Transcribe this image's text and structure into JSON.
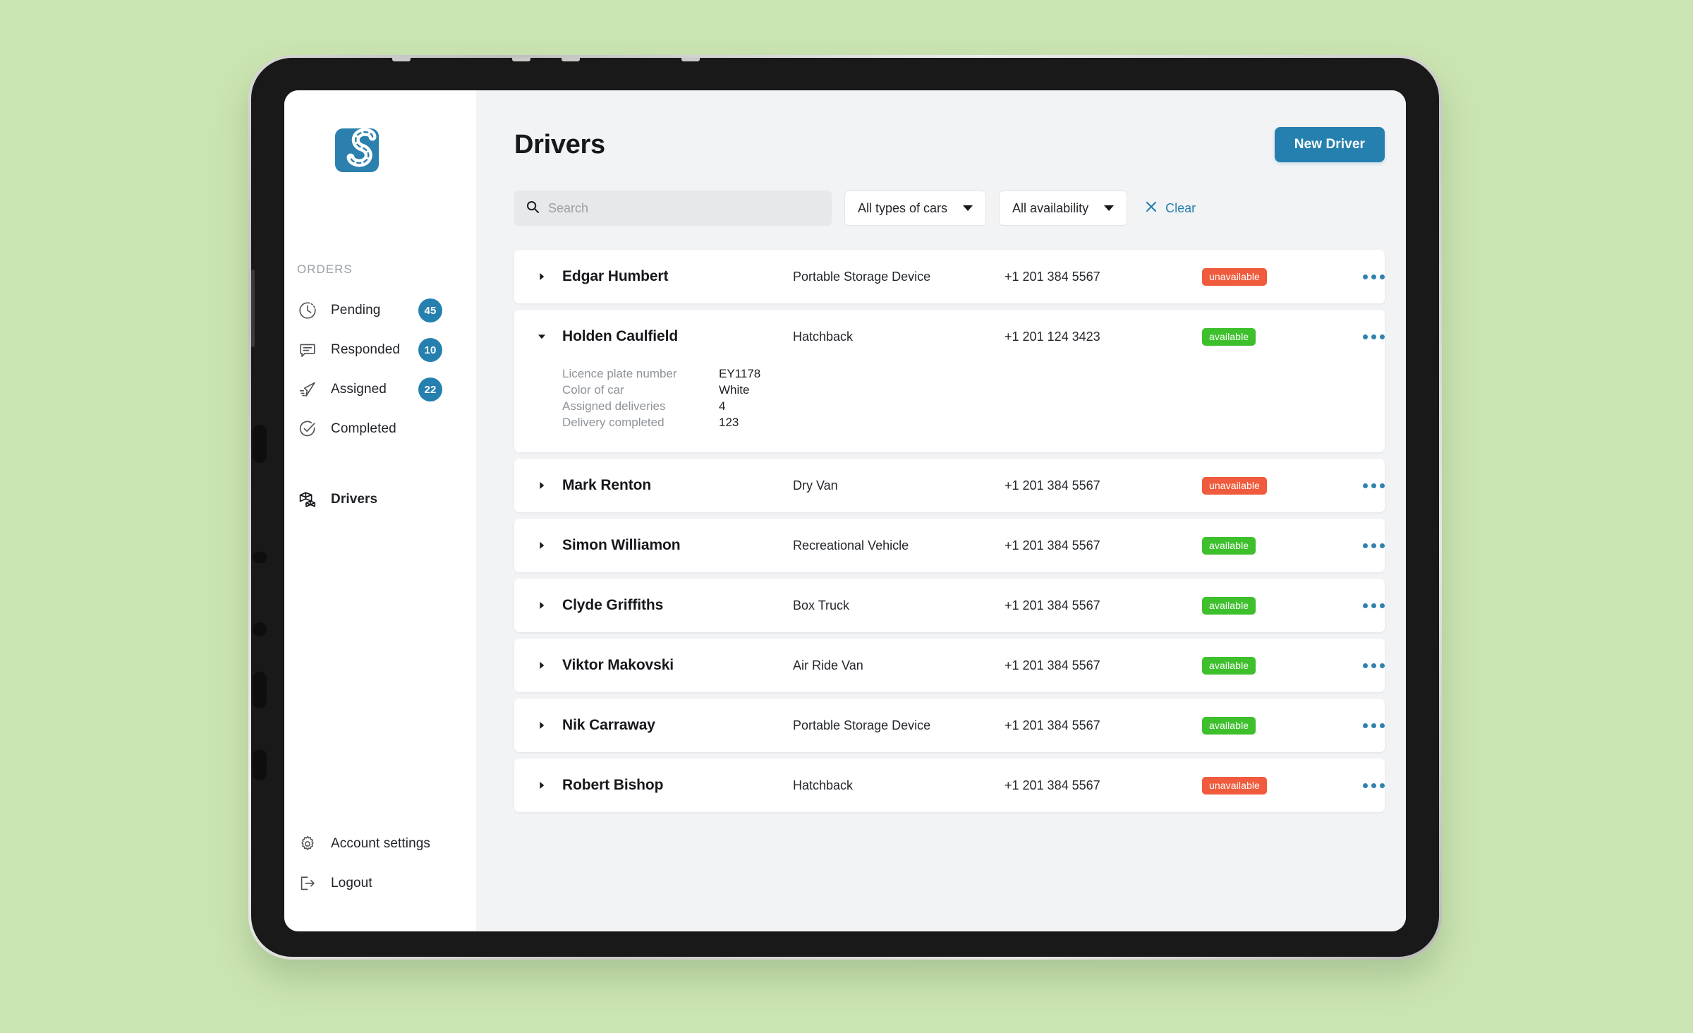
{
  "app": {
    "logo_name": "sorted-logo",
    "accent_blue": "#2680af",
    "available_green": "#3ec02d",
    "unavailable_red": "#ef5b3c",
    "page_background": "#cbe5b2"
  },
  "sidebar": {
    "section_label": "ORDERS",
    "items": [
      {
        "label": "Pending",
        "badge": "45",
        "icon": "clock-dashed-icon",
        "active": false
      },
      {
        "label": "Responded",
        "badge": "10",
        "icon": "speech-bubble-icon",
        "active": false
      },
      {
        "label": "Assigned",
        "badge": "22",
        "icon": "paper-plane-icon",
        "active": false
      },
      {
        "label": "Completed",
        "badge": "",
        "icon": "check-circle-icon",
        "active": false
      }
    ],
    "primary": {
      "label": "Drivers",
      "icon": "boxes-icon",
      "active": true
    },
    "bottom": [
      {
        "label": "Account settings",
        "icon": "gear-icon"
      },
      {
        "label": "Logout",
        "icon": "logout-icon"
      }
    ]
  },
  "header": {
    "title": "Drivers",
    "new_driver_label": "New Driver"
  },
  "filters": {
    "search_placeholder": "Search",
    "search_value": "",
    "car_type": "All types of cars",
    "availability": "All availability",
    "clear_label": "Clear"
  },
  "detail_labels": {
    "plate": "Licence plate number",
    "color": "Color of car",
    "assigned": "Assigned deliveries",
    "completed": "Delivery completed"
  },
  "drivers": [
    {
      "name": "Edgar Humbert",
      "car": "Portable Storage Device",
      "phone": "+1 201 384 5567",
      "status": "unavailable",
      "expanded": false
    },
    {
      "name": "Holden Caulfield",
      "car": "Hatchback",
      "phone": "+1 201 124 3423",
      "status": "available",
      "expanded": true,
      "details": {
        "plate": "EY1178",
        "color": "White",
        "assigned": "4",
        "completed": "123"
      }
    },
    {
      "name": "Mark Renton",
      "car": "Dry Van",
      "phone": "+1 201 384 5567",
      "status": "unavailable",
      "expanded": false
    },
    {
      "name": "Simon Williamon",
      "car": "Recreational Vehicle",
      "phone": "+1 201 384 5567",
      "status": "available",
      "expanded": false
    },
    {
      "name": "Clyde Griffiths",
      "car": "Box Truck",
      "phone": "+1 201 384 5567",
      "status": "available",
      "expanded": false
    },
    {
      "name": "Viktor Makovski",
      "car": "Air Ride Van",
      "phone": "+1 201 384 5567",
      "status": "available",
      "expanded": false
    },
    {
      "name": "Nik Carraway",
      "car": "Portable Storage Device",
      "phone": "+1 201 384 5567",
      "status": "available",
      "expanded": false
    },
    {
      "name": "Robert Bishop",
      "car": "Hatchback",
      "phone": "+1 201 384 5567",
      "status": "unavailable",
      "expanded": false
    }
  ]
}
